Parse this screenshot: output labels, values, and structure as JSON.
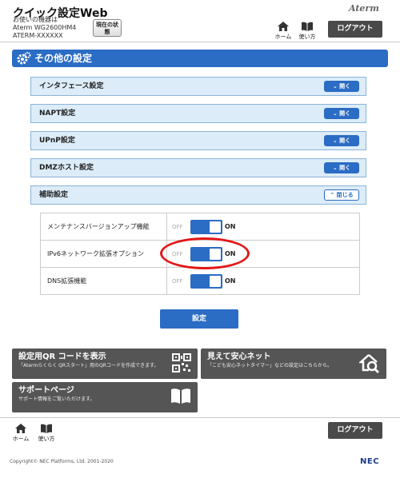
{
  "header": {
    "title": "クイック設定Web",
    "device_label": "お使いの機器は",
    "device_model": "Aterm WG2600HM4",
    "device_id": "ATERM-XXXXXX",
    "status_button": "現在の状態",
    "brand": "Aterm",
    "home": "ホーム",
    "help": "使い方",
    "logout": "ログアウト"
  },
  "section": {
    "title": "その他の設定"
  },
  "accordions": [
    {
      "label": "インタフェース設定",
      "button": "開く"
    },
    {
      "label": "NAPT設定",
      "button": "開く"
    },
    {
      "label": "UPnP設定",
      "button": "開く"
    },
    {
      "label": "DMZホスト設定",
      "button": "開く"
    },
    {
      "label": "補助設定",
      "button": "閉じる"
    }
  ],
  "settings": [
    {
      "label": "メンテナンスバージョンアップ機能",
      "off": "OFF",
      "on": "ON",
      "state": "on"
    },
    {
      "label": "IPv6ネットワーク拡張オプション",
      "off": "OFF",
      "on": "ON",
      "state": "on"
    },
    {
      "label": "DNS拡張機能",
      "off": "OFF",
      "on": "ON",
      "state": "on"
    }
  ],
  "submit_label": "設定",
  "cards": {
    "qr": {
      "title": "設定用QR コードを表示",
      "desc": "「Atermらくらく QRスタート」用のQRコードを作成できます。",
      "icon": "qr-code-icon"
    },
    "safe": {
      "title": "見えて安心ネット",
      "desc": "「こども安心ネットタイマー」などの設定はこちらから。",
      "icon": "home-search-icon"
    },
    "support": {
      "title": "サポートページ",
      "desc": "サポート情報をご覧いただけます。",
      "icon": "book-icon"
    }
  },
  "footer": {
    "home": "ホーム",
    "help": "使い方",
    "logout": "ログアウト",
    "copyright": "Copyright© NEC Platforms, Ltd. 2001-2020",
    "brand": "NEC"
  },
  "colors": {
    "accent": "#2b6cc4",
    "accordion_bg": "#dcecf8",
    "highlight": "#e31818",
    "card_bg": "#555555"
  }
}
